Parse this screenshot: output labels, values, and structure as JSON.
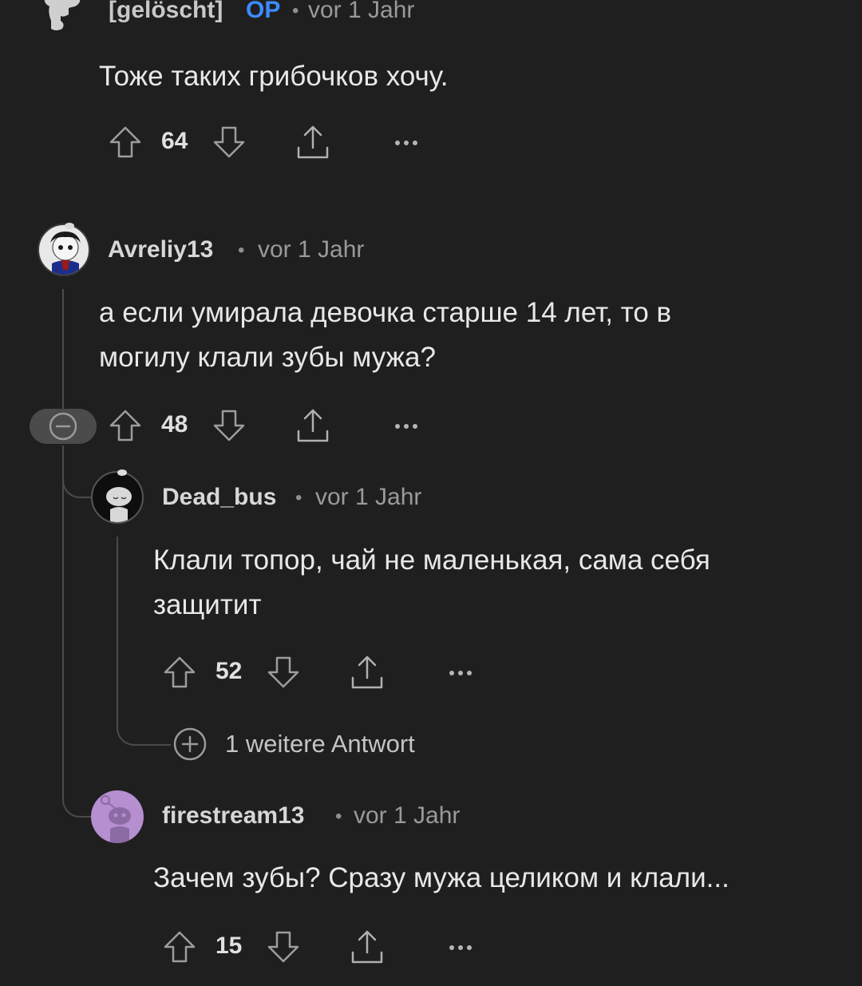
{
  "comments": [
    {
      "author": "[gelöscht]",
      "badge": "OP",
      "separator": "•",
      "time": "vor 1 Jahr",
      "text": "Тоже таких грибочков хочу.",
      "votes": "64"
    },
    {
      "author": "Avreliy13",
      "separator": "•",
      "time": "vor 1 Jahr",
      "text_lines": [
        "а если умирала девочка старше 14 лет, то в",
        "могилу клали зубы мужа?"
      ],
      "votes": "48"
    },
    {
      "author": "Dead_bus",
      "separator": "•",
      "time": "vor 1 Jahr",
      "text_lines": [
        "Клали топор, чай не маленькая, сама себя",
        "защитит"
      ],
      "votes": "52",
      "more_replies": "1 weitere Antwort"
    },
    {
      "author": "firestream13",
      "separator": "•",
      "time": "vor 1 Jahr",
      "text": "Зачем зубы? Сразу мужа целиком и клали...",
      "votes": "15"
    }
  ],
  "icons": {
    "upvote": "upvote-icon",
    "downvote": "downvote-icon",
    "share": "share-icon",
    "more": "more-options-icon",
    "collapse": "collapse-minus-icon",
    "expand": "expand-plus-icon"
  },
  "colors": {
    "background": "#1f1f20",
    "op_badge": "#3d8bff",
    "thread_line": "#4a4a4a",
    "avatar_purple": "#b58fd0"
  }
}
